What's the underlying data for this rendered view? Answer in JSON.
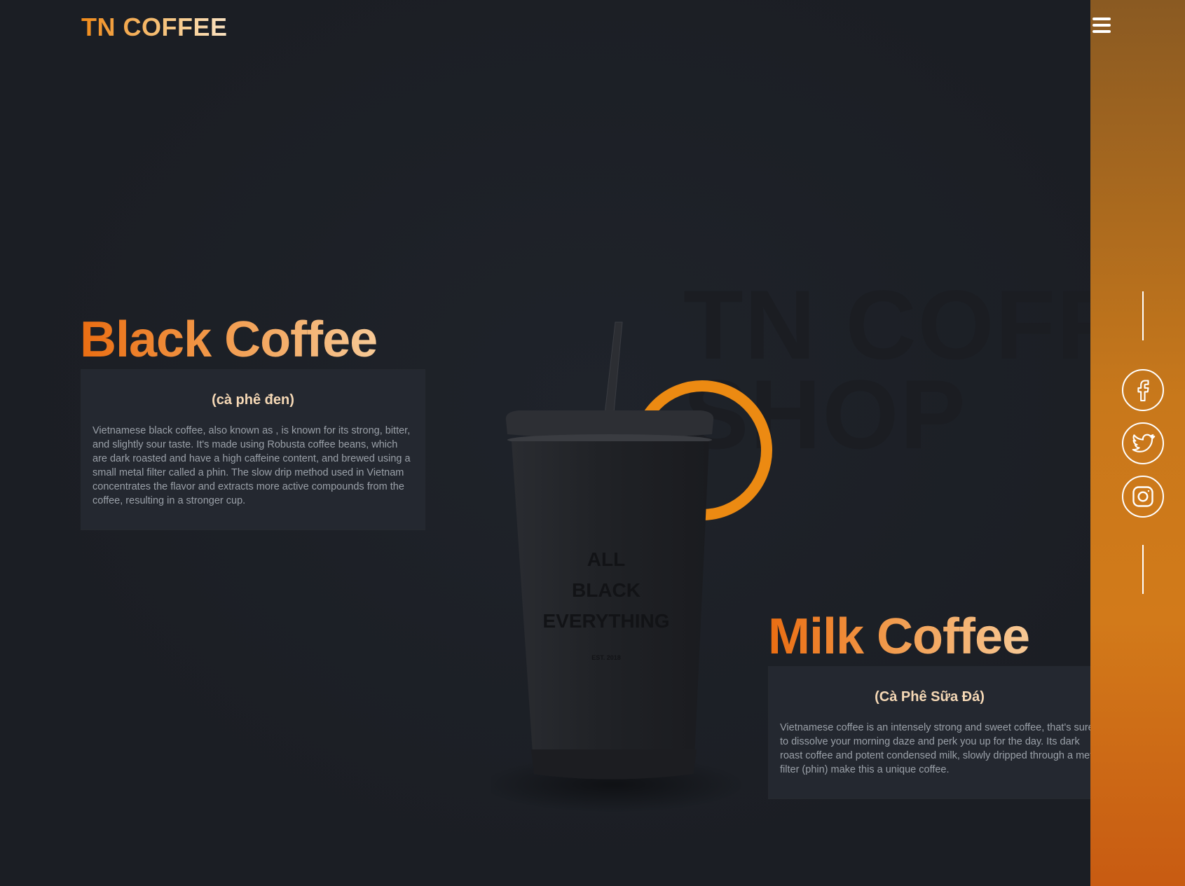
{
  "brand": {
    "logo": "TN COFFEE"
  },
  "watermark": {
    "line1": "TN COFFE",
    "line2": "SHOP"
  },
  "cup": {
    "line1": "ALL",
    "line2": "BLACK",
    "line3": "EVERYTHING",
    "est": "EST. 2018"
  },
  "products": [
    {
      "name": "Black Coffee",
      "subtitle": "(cà phê đen)",
      "description": "Vietnamese black coffee, also known as , is known for its strong, bitter, and slightly sour taste. It's made using Robusta coffee beans, which are dark roasted and have a high caffeine content, and brewed using a small metal filter called a phin. The slow drip method used in Vietnam concentrates the flavor and extracts more active compounds from the coffee, resulting in a stronger cup."
    },
    {
      "name": "Milk Coffee",
      "subtitle": "(Cà Phê Sữa Đá)",
      "description": "Vietnamese coffee is an intensely strong and sweet coffee, that's sure to dissolve your morning daze and perk you up for the day. Its dark roast coffee and potent condensed milk, slowly dripped through a metal filter (phin) make this a unique coffee."
    }
  ],
  "sidebar": {
    "menu_icon": "hamburger-icon",
    "socials": [
      "facebook-icon",
      "twitter-icon",
      "instagram-icon"
    ]
  },
  "colors": {
    "accent": "#ec8a12",
    "background": "#1d2027",
    "card": "#242830"
  }
}
